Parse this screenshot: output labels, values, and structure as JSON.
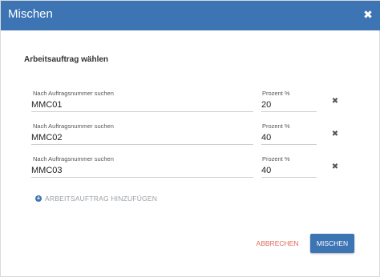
{
  "dialog": {
    "title": "Mischen",
    "close_icon": "close-icon"
  },
  "section": {
    "title": "Arbeitsauftrag wählen"
  },
  "rows": [
    {
      "order_label": "Nach Auftragsnummer suchen",
      "order_value": "MMC01",
      "percent_label": "Prozent %",
      "percent_value": "20"
    },
    {
      "order_label": "Nach Auftragsnummer suchen",
      "order_value": "MMC02",
      "percent_label": "Prozent %",
      "percent_value": "40"
    },
    {
      "order_label": "Nach Auftragsnummer suchen",
      "order_value": "MMC03",
      "percent_label": "Prozent %",
      "percent_value": "40"
    }
  ],
  "add": {
    "label": "ARBEITSAUFTRAG HINZUFÜGEN",
    "icon": "plus-circle-icon"
  },
  "footer": {
    "cancel_label": "ABBRECHEN",
    "confirm_label": "MISCHEN"
  },
  "colors": {
    "primary": "#3d74b4",
    "cancel": "#e0675a"
  }
}
